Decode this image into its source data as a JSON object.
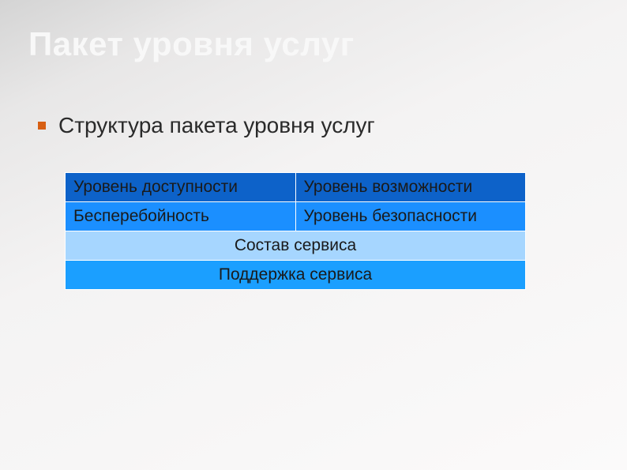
{
  "slide": {
    "title": "Пакет уровня услуг",
    "subtitle": "Структура пакета уровня услуг"
  },
  "table": {
    "row1": {
      "c1": "Уровень доступности",
      "c2": "Уровень возможности"
    },
    "row2": {
      "c1": "Бесперебойность",
      "c2": "Уровень безопасности"
    },
    "row3": "Состав сервиса",
    "row4": "Поддержка сервиса"
  },
  "colors": {
    "bullet": "#d75f13",
    "row_dark": "#0d62c9",
    "row_blue": "#1b8fff",
    "row_light": "#a6d6ff",
    "row_mid": "#1b9fff"
  }
}
